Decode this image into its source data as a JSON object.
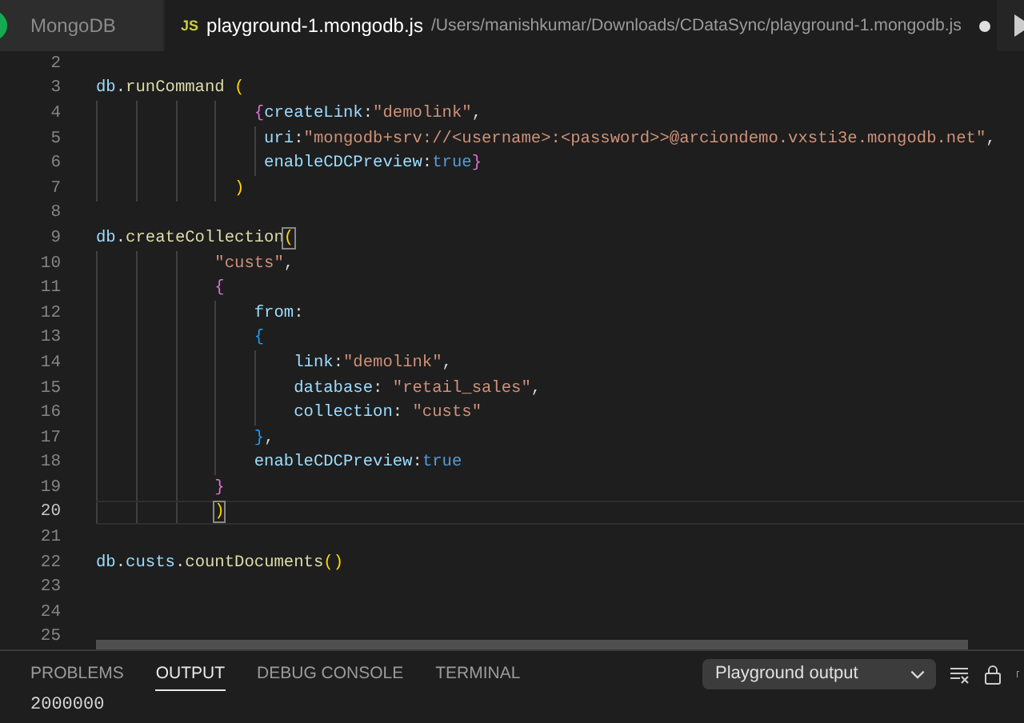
{
  "tabs": [
    {
      "label": "MongoDB",
      "selected": false
    },
    {
      "icon_text": "JS",
      "label": "playground-1.mongodb.js",
      "path": "/Users/manishkumar/Downloads/CDataSync/playground-1.mongodb.js",
      "modified": true,
      "selected": true
    }
  ],
  "editor": {
    "lines": [
      {
        "number": "2",
        "current": false
      },
      {
        "number": "3",
        "current": false,
        "tokens": [
          {
            "kind": "var",
            "text": "db"
          },
          {
            "kind": "plain",
            "text": "."
          },
          {
            "kind": "fn",
            "text": "runCommand"
          },
          {
            "kind": "brace1",
            "text": " ("
          }
        ]
      },
      {
        "number": "4",
        "current": false,
        "tokens": [
          {
            "kind": "brace2",
            "text": "                {"
          },
          {
            "kind": "var",
            "text": "createLink"
          },
          {
            "kind": "plain",
            "text": ":"
          },
          {
            "kind": "str",
            "text": "\"demolink\""
          },
          {
            "kind": "plain",
            "text": ","
          }
        ]
      },
      {
        "number": "5",
        "current": false,
        "tokens": [
          {
            "kind": "var",
            "text": "                 uri"
          },
          {
            "kind": "plain",
            "text": ":"
          },
          {
            "kind": "str",
            "text": "\"mongodb+srv://<username>:<password>>@arciondemo.vxsti3e.mongodb.net\""
          },
          {
            "kind": "plain",
            "text": ","
          }
        ]
      },
      {
        "number": "6",
        "current": false,
        "tokens": [
          {
            "kind": "var",
            "text": "                 enableCDCPreview"
          },
          {
            "kind": "plain",
            "text": ":"
          },
          {
            "kind": "bool",
            "text": "true"
          },
          {
            "kind": "brace2",
            "text": "}"
          }
        ]
      },
      {
        "number": "7",
        "current": false,
        "tokens": [
          {
            "kind": "brace1",
            "text": "              )"
          }
        ]
      },
      {
        "number": "8",
        "current": false
      },
      {
        "number": "9",
        "current": false,
        "tokens": [
          {
            "kind": "var",
            "text": "db"
          },
          {
            "kind": "plain",
            "text": "."
          },
          {
            "kind": "fn",
            "text": "createCollection"
          },
          {
            "kind": "brace1",
            "text": "(",
            "matched": true
          }
        ]
      },
      {
        "number": "10",
        "current": false,
        "tokens": [
          {
            "kind": "str",
            "text": "            \"custs\""
          },
          {
            "kind": "plain",
            "text": ","
          }
        ]
      },
      {
        "number": "11",
        "current": false,
        "tokens": [
          {
            "kind": "brace2",
            "text": "            {"
          }
        ]
      },
      {
        "number": "12",
        "current": false,
        "tokens": [
          {
            "kind": "var",
            "text": "                from"
          },
          {
            "kind": "plain",
            "text": ":"
          }
        ]
      },
      {
        "number": "13",
        "current": false,
        "tokens": [
          {
            "kind": "brace3",
            "text": "                {"
          }
        ]
      },
      {
        "number": "14",
        "current": false,
        "tokens": [
          {
            "kind": "var",
            "text": "                    link"
          },
          {
            "kind": "plain",
            "text": ":"
          },
          {
            "kind": "str",
            "text": "\"demolink\""
          },
          {
            "kind": "plain",
            "text": ","
          }
        ]
      },
      {
        "number": "15",
        "current": false,
        "tokens": [
          {
            "kind": "var",
            "text": "                    database"
          },
          {
            "kind": "plain",
            "text": ": "
          },
          {
            "kind": "str",
            "text": "\"retail_sales\""
          },
          {
            "kind": "plain",
            "text": ","
          }
        ]
      },
      {
        "number": "16",
        "current": false,
        "tokens": [
          {
            "kind": "var",
            "text": "                    collection"
          },
          {
            "kind": "plain",
            "text": ": "
          },
          {
            "kind": "str",
            "text": "\"custs\""
          }
        ]
      },
      {
        "number": "17",
        "current": false,
        "tokens": [
          {
            "kind": "brace3",
            "text": "                }"
          },
          {
            "kind": "plain",
            "text": ","
          }
        ]
      },
      {
        "number": "18",
        "current": false,
        "tokens": [
          {
            "kind": "var",
            "text": "                enableCDCPreview"
          },
          {
            "kind": "plain",
            "text": ":"
          },
          {
            "kind": "bool",
            "text": "true"
          }
        ]
      },
      {
        "number": "19",
        "current": false,
        "tokens": [
          {
            "kind": "brace2",
            "text": "            }"
          }
        ]
      },
      {
        "number": "20",
        "current": true,
        "tokens": [
          {
            "kind": "brace1",
            "text": "            )",
            "matched": true
          }
        ]
      },
      {
        "number": "21",
        "current": false
      },
      {
        "number": "22",
        "current": false,
        "tokens": [
          {
            "kind": "var",
            "text": "db"
          },
          {
            "kind": "plain",
            "text": "."
          },
          {
            "kind": "var",
            "text": "custs"
          },
          {
            "kind": "plain",
            "text": "."
          },
          {
            "kind": "fn",
            "text": "countDocuments"
          },
          {
            "kind": "brace1",
            "text": "()"
          }
        ]
      },
      {
        "number": "23",
        "current": false
      },
      {
        "number": "24",
        "current": false
      },
      {
        "number": "25",
        "current": false
      }
    ]
  },
  "panel": {
    "tabs": [
      {
        "label": "PROBLEMS",
        "selected": false
      },
      {
        "label": "OUTPUT",
        "selected": true
      },
      {
        "label": "DEBUG CONSOLE",
        "selected": false
      },
      {
        "label": "TERMINAL",
        "selected": false
      }
    ],
    "output_channel": "Playground output",
    "output": "2000000"
  }
}
